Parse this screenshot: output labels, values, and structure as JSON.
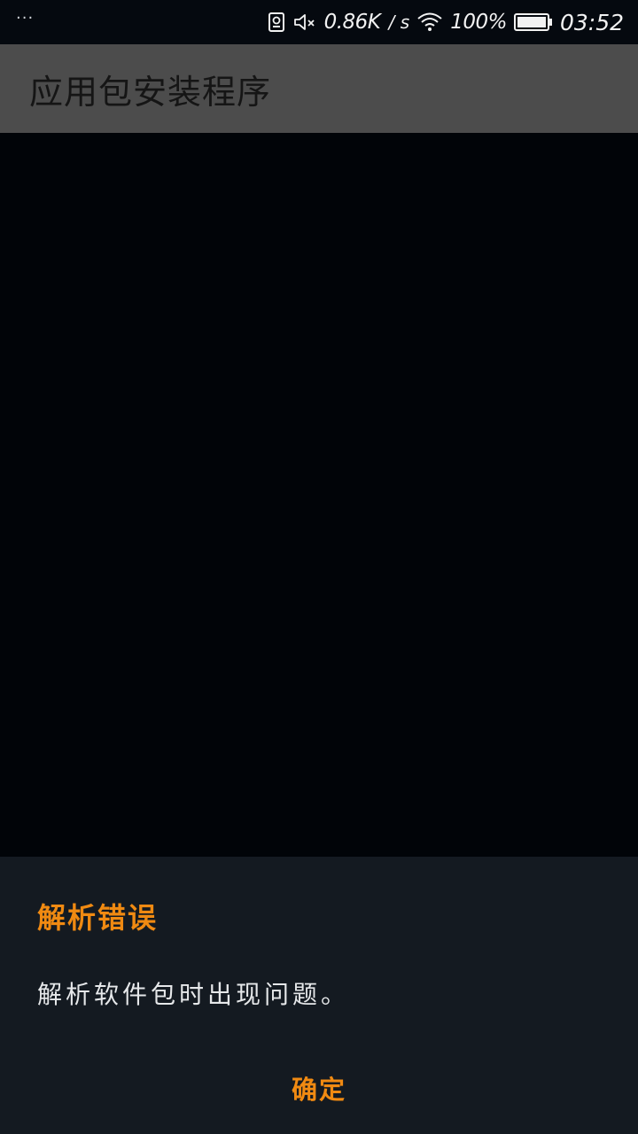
{
  "status_bar": {
    "overflow_dots": "···",
    "net_speed": "0.86K",
    "net_unit": "/ s",
    "battery_percent": "100%",
    "time": "03:52",
    "icons": [
      "sim-icon",
      "mute-icon",
      "wifi-icon",
      "battery-icon"
    ]
  },
  "app_bar": {
    "title": "应用包安装程序"
  },
  "dialog": {
    "title": "解析错误",
    "message": "解析软件包时出现问题。",
    "confirm_label": "确定"
  },
  "colors": {
    "accent": "#f08a12",
    "app_bar_bg": "#4c4c4c",
    "dialog_bg": "#141a21",
    "background": "#010408"
  }
}
